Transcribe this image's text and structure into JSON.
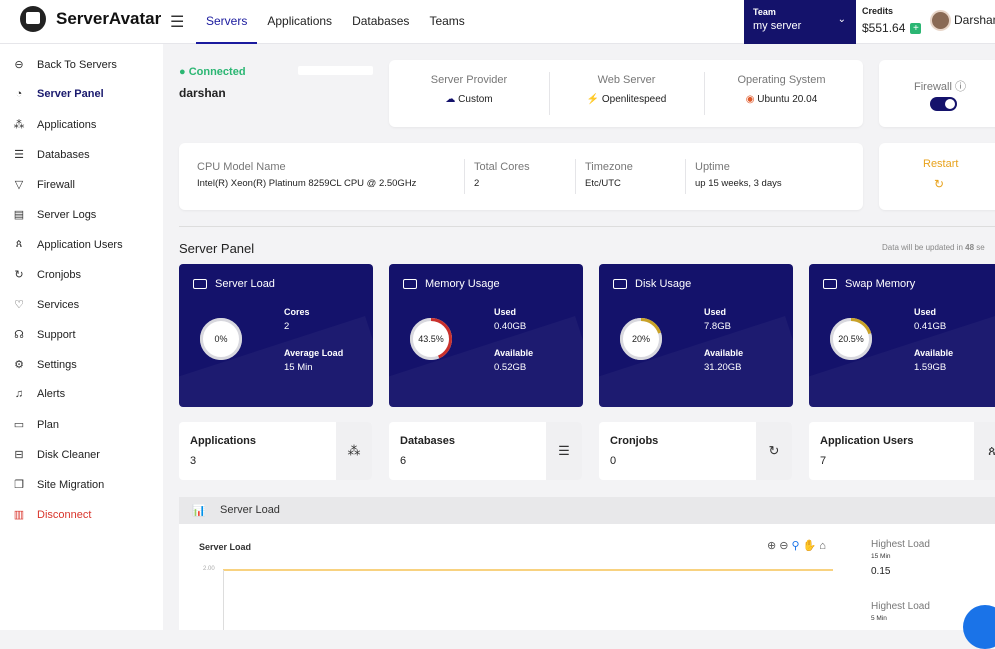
{
  "brand": {
    "name": "ServerAvatar"
  },
  "nav": {
    "items": [
      "Servers",
      "Applications",
      "Databases",
      "Teams"
    ],
    "active": "Servers"
  },
  "team": {
    "label": "Team",
    "value": "my server"
  },
  "credits": {
    "label": "Credits",
    "value": "$551.64"
  },
  "user": {
    "name": "Darshan"
  },
  "sidebar": {
    "items": [
      {
        "label": "Back To Servers",
        "icon": "arrow-left-icon"
      },
      {
        "label": "Server Panel",
        "icon": "dashboard-icon"
      },
      {
        "label": "Applications",
        "icon": "apps-icon"
      },
      {
        "label": "Databases",
        "icon": "database-icon"
      },
      {
        "label": "Firewall",
        "icon": "shield-icon"
      },
      {
        "label": "Server Logs",
        "icon": "logs-icon"
      },
      {
        "label": "Application Users",
        "icon": "users-icon"
      },
      {
        "label": "Cronjobs",
        "icon": "refresh-icon"
      },
      {
        "label": "Services",
        "icon": "services-icon"
      },
      {
        "label": "Support",
        "icon": "support-icon"
      },
      {
        "label": "Settings",
        "icon": "settings-icon"
      },
      {
        "label": "Alerts",
        "icon": "bell-icon"
      },
      {
        "label": "Plan",
        "icon": "card-icon"
      },
      {
        "label": "Disk Cleaner",
        "icon": "disk-icon"
      },
      {
        "label": "Site Migration",
        "icon": "copy-icon"
      },
      {
        "label": "Disconnect",
        "icon": "trash-icon"
      }
    ]
  },
  "server": {
    "status": "Connected",
    "name": "darshan"
  },
  "info": {
    "provider": {
      "label": "Server Provider",
      "value": "Custom"
    },
    "webserver": {
      "label": "Web Server",
      "value": "Openlitespeed"
    },
    "os": {
      "label": "Operating System",
      "value": "Ubuntu 20.04"
    },
    "firewall": {
      "label": "Firewall",
      "icon": "info-icon",
      "enabled": true
    }
  },
  "specs": {
    "cpu": {
      "label": "CPU Model Name",
      "value": "Intel(R) Xeon(R) Platinum 8259CL CPU @ 2.50GHz"
    },
    "cores": {
      "label": "Total Cores",
      "value": "2"
    },
    "timezone": {
      "label": "Timezone",
      "value": "Etc/UTC"
    },
    "uptime": {
      "label": "Uptime",
      "value": "up 15 weeks, 3 days"
    },
    "restart": {
      "label": "Restart"
    }
  },
  "panel": {
    "title": "Server Panel",
    "update_prefix": "Data will be updated in ",
    "update_count": "48",
    "update_suffix": " se"
  },
  "metrics": [
    {
      "title": "Server Load",
      "percent": "0%",
      "fraction": 0,
      "k1": "Cores",
      "v1": "2",
      "k2": "Average Load",
      "v2": "15 Min",
      "icon": "cpu-icon"
    },
    {
      "title": "Memory Usage",
      "percent": "43.5%",
      "fraction": 0.435,
      "k1": "Used",
      "v1": "0.40GB",
      "k2": "Available",
      "v2": "0.52GB",
      "icon": "memory-icon"
    },
    {
      "title": "Disk Usage",
      "percent": "20%",
      "fraction": 0.2,
      "k1": "Used",
      "v1": "7.8GB",
      "k2": "Available",
      "v2": "31.20GB",
      "icon": "disk-icon"
    },
    {
      "title": "Swap Memory",
      "percent": "20.5%",
      "fraction": 0.205,
      "k1": "Used",
      "v1": "0.41GB",
      "k2": "Available",
      "v2": "1.59GB",
      "icon": "swap-icon"
    }
  ],
  "counts": [
    {
      "label": "Applications",
      "value": "3",
      "icon": "apps-icon"
    },
    {
      "label": "Databases",
      "value": "6",
      "icon": "database-icon"
    },
    {
      "label": "Cronjobs",
      "value": "0",
      "icon": "refresh-icon"
    },
    {
      "label": "Application Users",
      "value": "7",
      "icon": "users-icon"
    }
  ],
  "chart_section": {
    "title": "Server Load"
  },
  "chart_data": {
    "type": "line",
    "title": "Server Load",
    "yticks": [
      "2.00"
    ],
    "ylim": [
      0,
      2
    ]
  },
  "stats": [
    {
      "label": "Highest Load",
      "sub": "15 Min",
      "value": "0.15"
    },
    {
      "label": "Highest Load",
      "sub": "5 Min",
      "value": ""
    }
  ]
}
